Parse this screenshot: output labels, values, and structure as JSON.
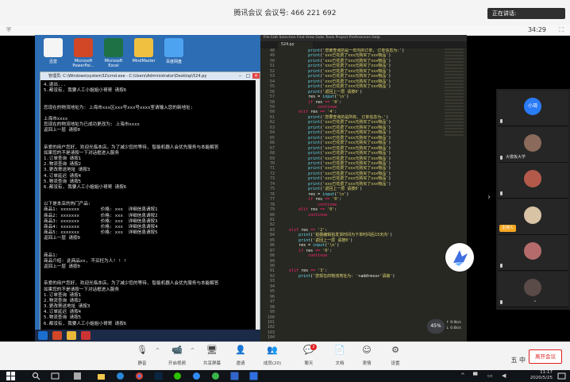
{
  "meeting": {
    "title": "腾讯会议 会议号: 466 221 692",
    "speaking_label": "正在讲话:",
    "timer": "34:29"
  },
  "desktop_icons": [
    {
      "label": "迅雷",
      "color": "#f5f5f5"
    },
    {
      "label": "Microsoft PowerPoi...",
      "color": "#d24726"
    },
    {
      "label": "Microsoft Excel",
      "color": "#1e7145"
    },
    {
      "label": "MindMaster",
      "color": "#f0c040"
    },
    {
      "label": "百度网盘",
      "color": "#4ea3f1"
    }
  ],
  "cmd": {
    "title": "管理员: C:\\Windows\\system32\\cmd.exe - C:\\Users\\Administrator\\Desktop\\524.py",
    "lines": [
      "4.退出...",
      "5.都没有, 我要人工小姐姐小哥哥 请按6",
      "",
      "",
      "您现在的物流地址为: 上海市xxx区xxx号xxx号xxxx室请输入您的新地址:",
      "",
      "上海市xxxx",
      "您现在的物流地址为已成功更改为: 上海市xxxx",
      "返回上一层 请按0",
      "",
      "",
      "亲爱的用户您好, 欢迎光临本店。为了减少您的等待, 智能机器人会优先服务与本能解答",
      "如果您的不是请按一下对话框进入服务",
      "1.订单查询 请按1",
      "2.物流查询 请按2",
      "3.更改寄送地址 请按3",
      "4.订单延迟 请按4",
      "5.物流查询 请按5",
      "6.都没有, 我要人工小姐姐小哥哥 请按6",
      "",
      "",
      "以下是本店的热门产品:",
      "商品1: xxxxxxx        价格: xxx  详细信息请按1",
      "商品2: xxxxxxx        价格: xxx  详细信息请按2",
      "商品3: xxxxxxx        价格: xxx  详细信息请按3",
      "商品4: xxxxxxx        价格: xxx  详细信息请按4",
      "商品5: xxxxxxx        价格: xxx  详细信息请按5",
      "返回上一层 请按0",
      "",
      "",
      "商品1:",
      "商品介绍: 此商品xx, 不买枉为人! ! !",
      "返回上一层 请按0",
      "",
      "",
      "亲爱的用户您好, 欢迎光临本店。为了减少您的等待, 智能机器人会优先服务与本能解答",
      "如果您的不是请按一下对话框进入服务",
      "1.订单查询 请按1",
      "2.物流查询 请按2",
      "3.更改寄送地址 请按3",
      "4.订单延迟 请按4",
      "5.物流查询 请按5",
      "6.都没有, 我要人工小姐姐小哥哥 请按6",
      "",
      "",
      "",
      "4"
    ]
  },
  "editor": {
    "menu": "File   Edit   Selection   Find   View   Goto   Tools   Project   Preferences   Help",
    "tab": "524.py",
    "line_numbers": [
      "48",
      "49",
      "50",
      "51",
      "52",
      "53",
      "54",
      "55",
      "56",
      "57",
      "58",
      "59",
      "60",
      "61",
      "62",
      "63",
      "64",
      "65",
      "66",
      "67",
      "68",
      "69",
      "70",
      "71",
      "72",
      "73",
      "74",
      "75",
      "76",
      "77",
      "78",
      "79",
      "80",
      "81",
      "82",
      "83",
      "84",
      "85",
      "86",
      "87",
      "88",
      "89",
      "90",
      "91",
      "92",
      "93",
      "94",
      "95",
      "96",
      "97",
      "98",
      "99",
      "100",
      "101",
      "102",
      "103",
      "104"
    ],
    "code": [
      "            print('您要查询的是一年内的订单, 订单信息为:')",
      "            print('xxx已花费了xxx元购买了xxx物品')",
      "            print('xxx已花费了xxx元购买了xxx物品')",
      "            print('xxx已花费了xxx元购买了xxx物品')",
      "            print('xxx已花费了xxx元购买了xxx物品')",
      "            print('xxx已花费了xxx元购买了xxx物品')",
      "            print('xxx已花费了xxx元购买了xxx物品')",
      "            print('xxx已花费了xxx元购买了xxx物品')",
      "            print('返回上一层 请按0')",
      "            res = input('\\n')",
      "            if res == '0':",
      "                continue",
      "        elif res == '4':",
      "            print('您要查询的是所有, 订单信息为:')",
      "            print('xxx已花费了xxx元购买了xxx物品')",
      "            print('xxx已花费了xxx元购买了xxx物品')",
      "            print('xxx已花费了xxx元购买了xxx物品')",
      "            print('xxx已花费了xxx元购买了xxx物品')",
      "            print('xxx已花费了xxx元购买了xxx物品')",
      "            print('xxx已花费了xxx元购买了xxx物品')",
      "            print('xxx已花费了xxx元购买了xxx物品')",
      "            print('xxx已花费了xxx元购买了xxx物品')",
      "            print('xxx已花费了xxx元购买了xxx物品')",
      "            print('xxx已花费了xxx元购买了xxx物品')",
      "            print('xxx已花费了xxx元购买了xxx物品')",
      "            print('xxx已花费了xxx元购买了xxx物品')",
      "            print('xxx已花费了xxx元购买了xxx物品')",
      "            print('返回上一层 请按0')",
      "            res = input('\\n')",
      "            if res == '0':",
      "                continue",
      "        elif res == '0':",
      "            continue",
      "",
      "",
      "    elif res == '2':",
      "        print('拍摄编辑拍发货时间为下单时间后15天内')",
      "        print('返回上一层 请按0')",
      "        res = input('\\n')",
      "        if res == '0':",
      "            continue",
      "",
      "",
      "    elif res == '3':",
      "        print('您现在的物流地址为: '+address+'请输')"
    ],
    "upload_percent": "45%",
    "net_speed": [
      "↑ 9.9k/s",
      "↓ 0.6k/s"
    ]
  },
  "participants": [
    {
      "name": "",
      "avatar_text": "小琦",
      "color": "#2a7bf6",
      "tag": ""
    },
    {
      "name": "大模板大学",
      "avatar_text": "",
      "color": "#8a6a5a",
      "tag": ""
    },
    {
      "name": "",
      "avatar_text": "",
      "color": "#b45a4a",
      "tag": ""
    },
    {
      "name": "",
      "avatar_text": "",
      "color": "#d8c3a5",
      "tag": "主持人"
    },
    {
      "name": "",
      "avatar_text": "",
      "color": "#b56b6b",
      "tag": ""
    },
    {
      "name": "",
      "avatar_text": "",
      "color": "#5a4a48",
      "tag": ""
    }
  ],
  "controls": [
    {
      "label": "静音",
      "icon": "🎙",
      "caret": true
    },
    {
      "label": "开启视频",
      "icon": "📹",
      "caret": true
    },
    {
      "label": "共享屏幕",
      "icon": "🖥",
      "caret": false
    },
    {
      "label": "邀请",
      "icon": "👤",
      "caret": false
    },
    {
      "label": "成员(20)",
      "icon": "👥",
      "caret": false
    },
    {
      "label": "聊天",
      "icon": "💬",
      "caret": false,
      "badge": "2"
    },
    {
      "label": "文档",
      "icon": "📄",
      "caret": false
    },
    {
      "label": "表情",
      "icon": "☺",
      "caret": false
    },
    {
      "label": "设置",
      "icon": "⚙",
      "caret": false
    }
  ],
  "leave_label": "离开会议",
  "ime": "五 中",
  "taskbar": {
    "time": "11:17",
    "date": "2020/5/25"
  }
}
